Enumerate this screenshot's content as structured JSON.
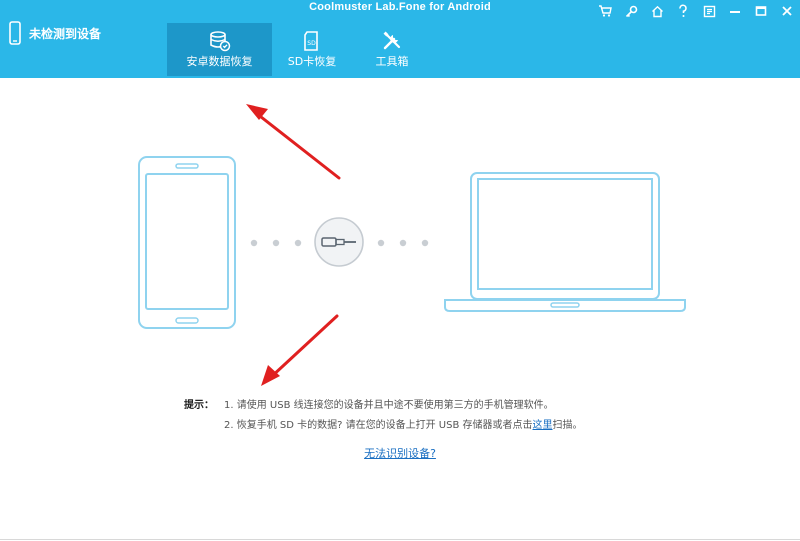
{
  "app": {
    "title": "Coolmuster Lab.Fone for Android"
  },
  "device": {
    "status": "未检测到设备"
  },
  "tabs": [
    {
      "label": "安卓数据恢复",
      "icon": "database-recover-icon",
      "active": true
    },
    {
      "label": "SD卡恢复",
      "icon": "sd-card-icon",
      "active": false
    },
    {
      "label": "工具箱",
      "icon": "tools-icon",
      "active": false
    }
  ],
  "window_controls": [
    "cart-icon",
    "key-icon",
    "home-icon",
    "help-icon",
    "feedback-icon",
    "minimize-icon",
    "maximize-icon",
    "close-icon"
  ],
  "tips": {
    "label": "提示：",
    "line1": "1. 请使用 USB 线连接您的设备并且中途不要使用第三方的手机管理软件。",
    "line2_before": "2. 恢复手机 SD 卡的数据? 请在您的设备上打开 USB 存储器或者点击",
    "line2_link": "这里",
    "line2_after": "扫描。"
  },
  "help_link": "无法识别设备?",
  "colors": {
    "header": "#2bb7e8",
    "active_tab": "#1d97c9",
    "device_outline": "#8fd3ef",
    "link": "#1a6fc2",
    "annotation_arrow": "#e02020"
  }
}
